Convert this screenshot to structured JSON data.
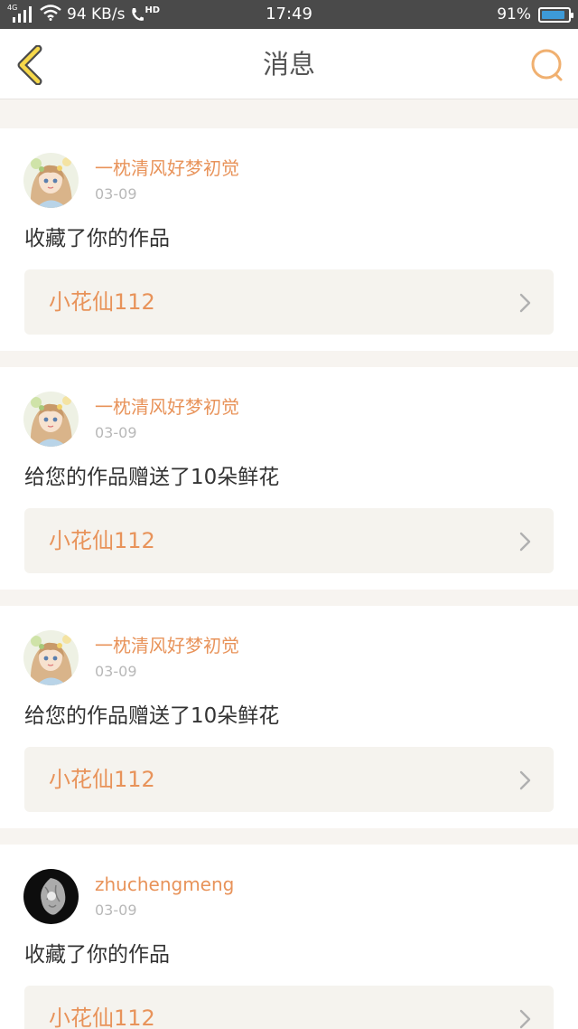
{
  "status_bar": {
    "network_tag": "4G",
    "speed": "94 KB/s",
    "hd_tag": "HD",
    "time": "17:49",
    "battery": "91%",
    "battery_level": 0.91,
    "battery_color": "#3d9ad8"
  },
  "header": {
    "title": "消息",
    "back_icon": "back-chevron-icon",
    "search_icon": "search-icon",
    "accent_color": "#f0b070"
  },
  "messages": [
    {
      "user": "一枕清风好梦初觉",
      "date": "03-09",
      "action": "收藏了你的作品",
      "work_title": "小花仙112",
      "avatar": "anime-girl-avatar"
    },
    {
      "user": "一枕清风好梦初觉",
      "date": "03-09",
      "action": "给您的作品赠送了10朵鲜花",
      "work_title": "小花仙112",
      "avatar": "anime-girl-avatar"
    },
    {
      "user": "一枕清风好梦初觉",
      "date": "03-09",
      "action": "给您的作品赠送了10朵鲜花",
      "work_title": "小花仙112",
      "avatar": "anime-girl-avatar"
    },
    {
      "user": "zhuchengmeng",
      "date": "03-09",
      "action": "收藏了你的作品",
      "work_title": "小花仙112",
      "avatar": "dark-avatar"
    }
  ],
  "colors": {
    "username": "#e8935a",
    "work_title": "#e8935a",
    "page_background": "#f7f4f0"
  }
}
